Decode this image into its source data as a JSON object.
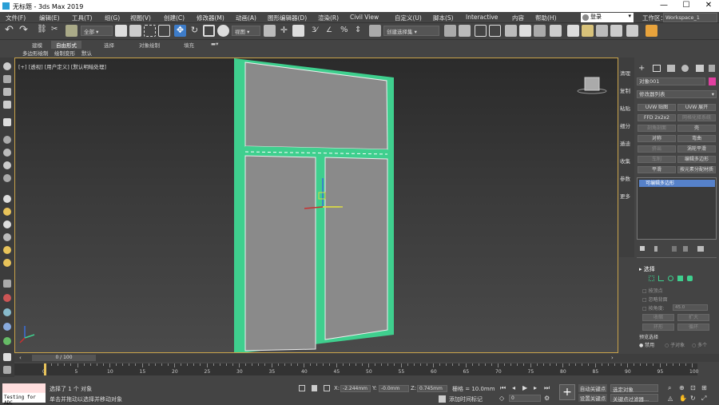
{
  "window": {
    "title": "无标题 - 3ds Max 2019",
    "min_glyph": "—",
    "max_glyph": "☐",
    "close_glyph": "✕"
  },
  "menu": {
    "items": [
      "文件(F)",
      "编辑(E)",
      "工具(T)",
      "组(G)",
      "视图(V)",
      "创建(C)",
      "修改器(M)",
      "动画(A)",
      "图形编辑器(D)",
      "渲染(R)",
      "Civil View",
      "自定义(U)",
      "脚本(S)",
      "Interactive",
      "内容",
      "帮助(H)"
    ],
    "signin": "登录",
    "workspace_label": "工作区：",
    "workspace_value": "Workspace_1"
  },
  "toolbar": {
    "filter_select": "全部",
    "coord_select": "视图",
    "selection_set": "创建选择集"
  },
  "ribbon": {
    "tabs": [
      "建模",
      "自由形式",
      "选择",
      "对象绘制",
      "填充"
    ],
    "active_tab": 1,
    "sub_items": [
      "多边形绘制",
      "绘制变形",
      "默认"
    ]
  },
  "viewport": {
    "label": "[+] [透视] [用户定义] [默认明暗处理]"
  },
  "command_panel": {
    "side_labels": [
      "清理",
      "复制",
      "粘贴",
      "细分",
      "遁迪",
      "收集",
      "参数",
      "更多"
    ],
    "object_name": "对象001",
    "object_color": "#e040a0",
    "modifier_list": "修改器列表",
    "buttons": [
      [
        "UVW 贴图",
        "UVW 展开"
      ],
      [
        "FFD 2x2x2",
        "网格化择系统"
      ],
      [
        "剖角剖面",
        "壳"
      ],
      [
        "对称",
        "弯曲"
      ],
      [
        "挤出",
        "涡轮平滑"
      ],
      [
        "车削",
        "编辑多边形"
      ],
      [
        "平滑",
        "按元素分配材质"
      ]
    ],
    "dim_buttons": [
      "网格化择系统",
      "剖角剖面",
      "挤出",
      "车削"
    ],
    "stack_item": "可编辑多边形",
    "selection_rollout": "选择",
    "rollout_options": [
      "按顶点",
      "忽略背面",
      "按角度:",
      "收缩",
      "扩大",
      "环形",
      "循环"
    ],
    "angle_value": "45.0",
    "preview_label": "预览选择",
    "preview_options": [
      "禁用",
      "子对象",
      "多个"
    ]
  },
  "timeline": {
    "frame_display": "0 / 100",
    "ticks": [
      0,
      5,
      10,
      15,
      20,
      25,
      30,
      35,
      40,
      45,
      50,
      55,
      60,
      65,
      70,
      75,
      80,
      85,
      90,
      95,
      100
    ]
  },
  "status": {
    "maxscript": "Testing for ADC",
    "selected": "选择了 1 个 对象",
    "hint": "单击并拖动以选择并移动对象",
    "x_label": "X:",
    "x_value": "-2.244mm",
    "y_label": "Y:",
    "y_value": "-0.0mm",
    "z_label": "Z:",
    "z_value": "0.745mm",
    "grid": "栅格 = 10.0mm",
    "add_time_tag": "添加时间标记",
    "frame": "0",
    "autokey": "自动关键点",
    "selected_obj": "选定对象",
    "setkey": "设置关键点",
    "key_filters": "关键点过滤器..."
  }
}
